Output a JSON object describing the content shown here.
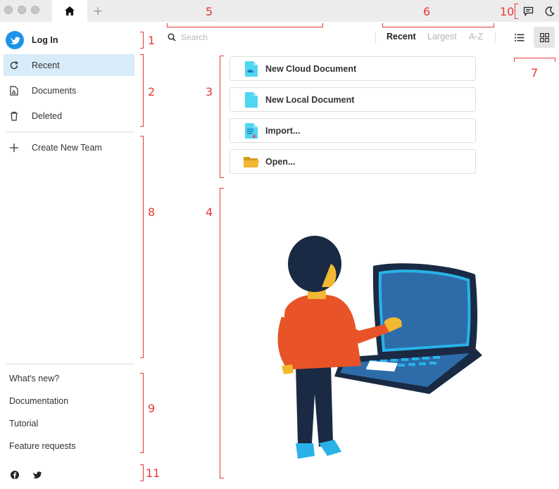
{
  "sidebar": {
    "login_label": "Log In",
    "items": [
      {
        "label": "Recent",
        "icon": "refresh-icon",
        "active": true
      },
      {
        "label": "Documents",
        "icon": "document-icon",
        "active": false
      },
      {
        "label": "Deleted",
        "icon": "trash-icon",
        "active": false
      }
    ],
    "create_team_label": "Create New Team",
    "footer_links": [
      "What's new?",
      "Documentation",
      "Tutorial",
      "Feature requests"
    ],
    "social": [
      "facebook-icon",
      "twitter-icon"
    ]
  },
  "search": {
    "placeholder": "Search",
    "value": ""
  },
  "sort": {
    "options": [
      "Recent",
      "Largest",
      "A-Z"
    ],
    "selected": "Recent"
  },
  "view": {
    "options": [
      "list-view",
      "grid-view"
    ],
    "selected": "grid-view"
  },
  "actions": [
    {
      "label": "New Cloud Document",
      "icon": "cloud-document-icon"
    },
    {
      "label": "New Local Document",
      "icon": "local-document-icon"
    },
    {
      "label": "Import...",
      "icon": "import-icon"
    },
    {
      "label": "Open...",
      "icon": "folder-icon"
    }
  ],
  "annotations": [
    "1",
    "2",
    "3",
    "4",
    "5",
    "6",
    "7",
    "8",
    "9",
    "10",
    "11"
  ],
  "colors": {
    "accent": "#1d93e8",
    "active_bg": "#d7ebf8",
    "annotation": "#e53935",
    "doc_cyan": "#4fd6f0"
  }
}
